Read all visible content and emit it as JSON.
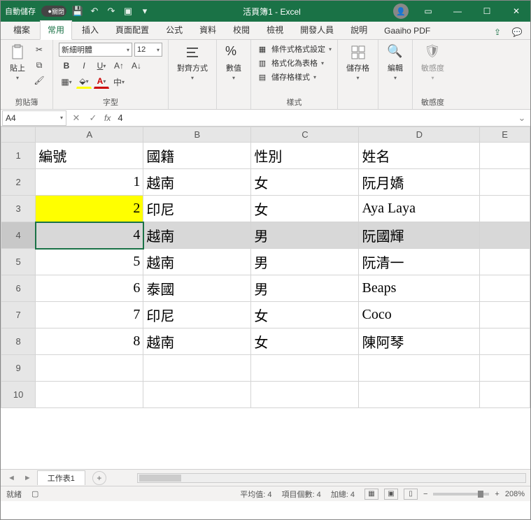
{
  "title": {
    "autosave": "自動儲存",
    "toggle": "關閉",
    "doc": "活頁簿1 - Excel"
  },
  "tabs": {
    "file": "檔案",
    "home": "常用",
    "insert": "插入",
    "layout": "頁面配置",
    "formula": "公式",
    "data": "資料",
    "review": "校閱",
    "view": "檢視",
    "dev": "開發人員",
    "help": "說明",
    "pdf": "Gaaiho PDF"
  },
  "ribbon": {
    "clipboard": {
      "paste": "貼上",
      "label": "剪貼簿"
    },
    "font": {
      "name": "新細明體",
      "size": "12",
      "label": "字型"
    },
    "align": {
      "btn": "對齊方式",
      "label": ""
    },
    "number": {
      "btn": "數值",
      "label": ""
    },
    "styles": {
      "cond": "條件式格式設定",
      "table": "格式化為表格",
      "cell": "儲存格樣式",
      "label": "樣式"
    },
    "cells": {
      "btn": "儲存格"
    },
    "editing": {
      "btn": "編輯"
    },
    "sens": {
      "btn": "敏感度",
      "label": "敏感度"
    }
  },
  "namebox": "A4",
  "formula": "4",
  "cols": [
    "A",
    "B",
    "C",
    "D",
    "E"
  ],
  "rows": [
    "1",
    "2",
    "3",
    "4",
    "5",
    "6",
    "7",
    "8",
    "9",
    "10"
  ],
  "chart_data": {
    "type": "table",
    "columns": [
      "編號",
      "國籍",
      "性別",
      "姓名"
    ],
    "records": [
      {
        "id": 1,
        "nat": "越南",
        "sex": "女",
        "name": "阮月嬌"
      },
      {
        "id": 2,
        "nat": "印尼",
        "sex": "女",
        "name": "Aya Laya"
      },
      {
        "id": 4,
        "nat": "越南",
        "sex": "男",
        "name": "阮國輝"
      },
      {
        "id": 5,
        "nat": "越南",
        "sex": "男",
        "name": "阮清一"
      },
      {
        "id": 6,
        "nat": "泰國",
        "sex": "男",
        "name": "Beaps"
      },
      {
        "id": 7,
        "nat": "印尼",
        "sex": "女",
        "name": "Coco"
      },
      {
        "id": 8,
        "nat": "越南",
        "sex": "女",
        "name": "陳阿琴"
      }
    ]
  },
  "sheet_tab": "工作表1",
  "status": {
    "ready": "就緒",
    "avg": "平均值: 4",
    "count": "項目個數: 4",
    "sum": "加總: 4",
    "zoom": "208%"
  }
}
